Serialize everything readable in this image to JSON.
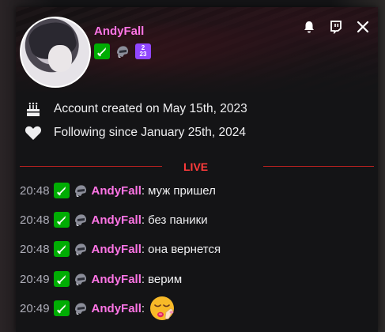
{
  "card": {
    "username": "AndyFall",
    "badges": [
      "moderator-badge",
      "helmet-badge",
      "year-2023-badge"
    ],
    "year_badge_text": [
      "2",
      "23"
    ],
    "icons": [
      "bell-icon",
      "twitch-icon",
      "close-icon"
    ]
  },
  "info": {
    "created": "Account created on May 15th, 2023",
    "following": "Following since January 25th, 2024"
  },
  "live_label": "LIVE",
  "messages": [
    {
      "time": "20:48",
      "user": "AndyFall",
      "text": "муж пришел"
    },
    {
      "time": "20:48",
      "user": "AndyFall",
      "text": "без паники"
    },
    {
      "time": "20:48",
      "user": "AndyFall",
      "text": "она вернется"
    },
    {
      "time": "20:49",
      "user": "AndyFall",
      "text": "верим"
    },
    {
      "time": "20:49",
      "user": "AndyFall",
      "text": "",
      "emote": "pleading-face-emote"
    }
  ],
  "colors": {
    "username": "#ff75e6",
    "live": "#ff3b3b",
    "mod_badge": "#00ad03",
    "year_badge": "#9146ff",
    "divider": "#b5201f"
  }
}
